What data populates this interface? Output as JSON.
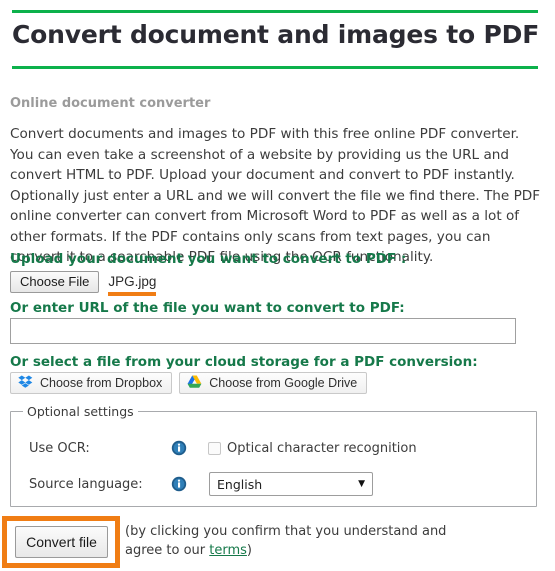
{
  "page": {
    "title": "Convert document and images to PDF",
    "subtitle": "Online document converter",
    "intro": "Convert documents and images to PDF with this free online PDF converter. You can even take a screenshot of a website by providing us the URL and convert HTML to PDF. Upload your document and convert to PDF instantly. Optionally just enter a URL and we will convert the file we find there. The PDF online converter can convert from Microsoft Word to PDF as well as a lot of other formats. If the PDF contains only scans from text pages, you can convert it to a searchable PDF file using the OCR functionality."
  },
  "upload": {
    "heading": "Upload your document you want to convert to PDF :",
    "choose_file_label": "Choose File",
    "file_name": "JPG.jpg"
  },
  "url": {
    "heading": "Or enter URL of the file you want to convert to PDF:",
    "value": "",
    "placeholder": ""
  },
  "cloud": {
    "heading": "Or select a file from your cloud storage for a PDF conversion:",
    "dropbox_label": "Choose from Dropbox",
    "google_drive_label": "Choose from Google Drive"
  },
  "optional_settings": {
    "legend": "Optional settings",
    "ocr_label": "Use OCR:",
    "ocr_checkbox_label": "Optical character recognition",
    "ocr_checked": false,
    "language_label": "Source language:",
    "language_value": "English",
    "language_arrow": "▼"
  },
  "footer": {
    "convert_label": "Convert file",
    "consent_prefix": "(by clicking you confirm that you understand and agree to our ",
    "terms_label": "terms",
    "consent_suffix": ")"
  },
  "colors": {
    "green_rule": "#0cb14b",
    "heading_green": "#16794a",
    "annotation_orange": "#f07d14",
    "subtitle_gray": "#9b9b9b"
  }
}
